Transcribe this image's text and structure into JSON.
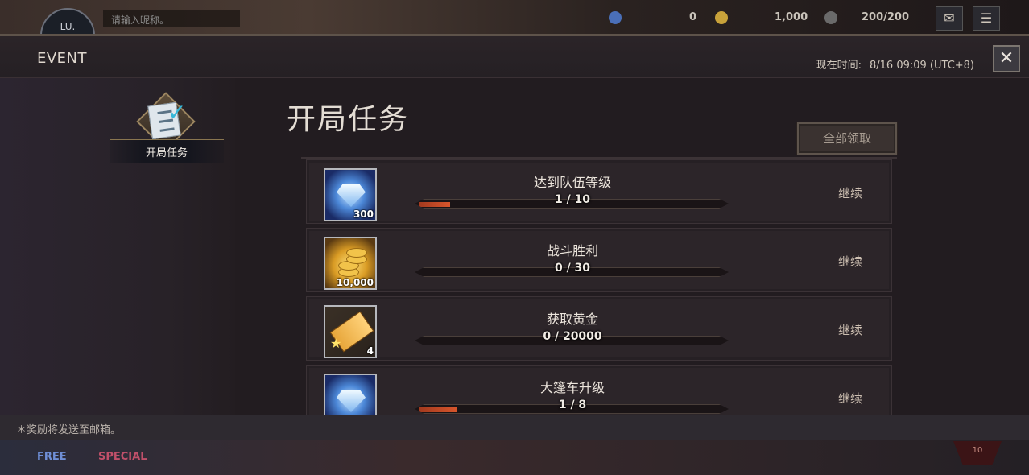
{
  "hud": {
    "avatar_text": "LU.",
    "name_placeholder": "请输入昵称。",
    "gems": "0",
    "gold": "1,000",
    "stamina": "200/200",
    "free_tab": "FREE",
    "special_tab": "SPECIAL",
    "rank": "10"
  },
  "modal": {
    "title": "EVENT",
    "time_label": "现在时间:",
    "time_value": "8/16 09:09 (UTC+8)",
    "close": "✕"
  },
  "sidebar": {
    "items": [
      {
        "label": "开局任务",
        "icon": "checklist-icon",
        "selected": true
      }
    ]
  },
  "main": {
    "title": "开局任务",
    "claim_all": "全部领取",
    "tasks": [
      {
        "name": "达到队伍等级",
        "progress_text": "1 / 10",
        "progress": 0.1,
        "reward_icon": "gem-icon",
        "reward_qty": "300",
        "status": "继续"
      },
      {
        "name": "战斗胜利",
        "progress_text": "0 / 30",
        "progress": 0.0,
        "reward_icon": "gold-coins-icon",
        "reward_qty": "10,000",
        "status": "继续"
      },
      {
        "name": "获取黄金",
        "progress_text": "0 / 20000",
        "progress": 0.0,
        "reward_icon": "ticket-icon",
        "reward_qty": "4",
        "status": "继续"
      },
      {
        "name": "大篷车升级",
        "progress_text": "1 / 8",
        "progress": 0.125,
        "reward_icon": "gem-icon",
        "reward_qty": "",
        "status": "继续"
      }
    ]
  },
  "footer": {
    "note": "＊奖励将发送至邮箱。"
  },
  "colors": {
    "progress_fill": "#d8562c",
    "modal_bg": "#241e22"
  }
}
